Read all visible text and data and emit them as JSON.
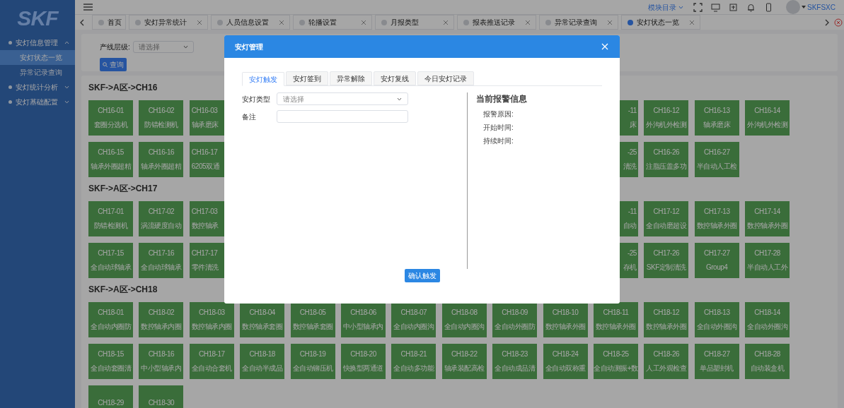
{
  "sidebar": {
    "logo": "SKF",
    "menu": [
      {
        "label": "安灯信息管理",
        "expanded": true,
        "children": [
          {
            "label": "安灯状态一览",
            "selected": true
          },
          {
            "label": "异常记录查询",
            "selected": false
          }
        ]
      },
      {
        "label": "安灯统计分析",
        "expanded": false
      },
      {
        "label": "安灯基础配置",
        "expanded": false
      }
    ]
  },
  "header": {
    "module_menu": "模块目录",
    "user": "SKFSXC"
  },
  "tabs": [
    {
      "label": "首页",
      "selected": false,
      "closable": false
    },
    {
      "label": "安灯异常统计",
      "selected": false,
      "closable": true
    },
    {
      "label": "人员信息设置",
      "selected": false,
      "closable": true
    },
    {
      "label": "轮播设置",
      "selected": false,
      "closable": true
    },
    {
      "label": "月报类型",
      "selected": false,
      "closable": true
    },
    {
      "label": "报表推送记录",
      "selected": false,
      "closable": true
    },
    {
      "label": "异常记录查询",
      "selected": false,
      "closable": true
    },
    {
      "label": "安灯状态一览",
      "selected": true,
      "closable": true
    }
  ],
  "filter": {
    "label": "产线层级:",
    "select": {
      "placeholder": "请选择"
    },
    "button": "查询"
  },
  "groups": [
    {
      "title": "SKF->A区->CH16",
      "rows": [
        {
          "left": [
            {
              "code": "CH16-01",
              "name": "套圈分选机"
            },
            {
              "code": "CH16-02",
              "name": "防错检测机"
            },
            {
              "code": "CH16-03",
              "name": "轴承磨床"
            }
          ],
          "right": [
            {
              "code": "-11",
              "name": "床"
            },
            {
              "code": "CH16-12",
              "name": "外沟机外检测"
            },
            {
              "code": "CH16-13",
              "name": "轴承磨床"
            },
            {
              "code": "CH16-14",
              "name": "外沟机外检测"
            }
          ]
        },
        {
          "left": [
            {
              "code": "CH16-15",
              "name": "轴承外圈超精"
            },
            {
              "code": "CH16-16",
              "name": "轴承外圈超精"
            },
            {
              "code": "CH16-17",
              "name": "6205双通"
            }
          ],
          "right": [
            {
              "code": "-25",
              "name": "清洗"
            },
            {
              "code": "CH16-26",
              "name": "注脂压盖多功"
            },
            {
              "code": "CH16-27",
              "name": "半自动人工检"
            }
          ]
        }
      ]
    },
    {
      "title": "SKF->A区->CH17",
      "rows": [
        {
          "left": [
            {
              "code": "CH17-01",
              "name": "防错检测机"
            },
            {
              "code": "CH17-02",
              "name": "涡流硬度自动"
            },
            {
              "code": "CH17-03",
              "name": "数控轴承"
            }
          ],
          "right": [
            {
              "code": "-11",
              "name": "自动"
            },
            {
              "code": "CH17-12",
              "name": "全自动磨超设"
            },
            {
              "code": "CH17-13",
              "name": "数控轴承外圈"
            },
            {
              "code": "CH17-14",
              "name": "数控轴承外圈"
            }
          ]
        },
        {
          "left": [
            {
              "code": "CH17-15",
              "name": "全自动球轴承"
            },
            {
              "code": "CH17-16",
              "name": "全自动球轴承"
            },
            {
              "code": "CH17-17",
              "name": "零件清洗"
            }
          ],
          "right": [
            {
              "code": "-25",
              "name": "存机"
            },
            {
              "code": "CH17-26",
              "name": "SKF定制清洗"
            },
            {
              "code": "CH17-27",
              "name": "Group4"
            },
            {
              "code": "CH17-28",
              "name": "半自动人工外"
            }
          ]
        }
      ]
    },
    {
      "title": "SKF->A区->CH18",
      "rows": [
        {
          "left": [
            {
              "code": "CH18-01",
              "name": "全自动内圈防"
            },
            {
              "code": "CH18-02",
              "name": "数控轴承内圈"
            },
            {
              "code": "CH18-03",
              "name": "数控轴承内圈"
            },
            {
              "code": "CH18-04",
              "name": "数控轴承套圈"
            },
            {
              "code": "CH18-05",
              "name": "数控轴承套圈"
            },
            {
              "code": "CH18-06",
              "name": "中小型轴承内"
            },
            {
              "code": "CH18-07",
              "name": "全自动内圈沟"
            },
            {
              "code": "CH18-08",
              "name": "全自动内圈沟"
            },
            {
              "code": "CH18-09",
              "name": "全自动外圈防"
            },
            {
              "code": "CH18-10",
              "name": "数控轴承外圈"
            },
            {
              "code": "CH18-11",
              "name": "数控轴承外圈"
            },
            {
              "code": "CH18-12",
              "name": "数控轴承外圈"
            },
            {
              "code": "CH18-13",
              "name": "全自动外圈沟"
            },
            {
              "code": "CH18-14",
              "name": "全自动外圈沟"
            }
          ]
        },
        {
          "left": [
            {
              "code": "CH18-15",
              "name": "全自动套圈清"
            },
            {
              "code": "CH18-16",
              "name": "中小型轴承内"
            },
            {
              "code": "CH18-17",
              "name": "全自动合套机"
            },
            {
              "code": "CH18-18",
              "name": "全自动半成品"
            },
            {
              "code": "CH18-19",
              "name": "全自动铆压机"
            },
            {
              "code": "CH18-20",
              "name": "快换型两通道"
            },
            {
              "code": "CH18-21",
              "name": "全自动多功能"
            },
            {
              "code": "CH18-22",
              "name": "轴承装配高检"
            },
            {
              "code": "CH18-23",
              "name": "全自动成品清"
            },
            {
              "code": "CH18-24",
              "name": "全自动双称重"
            },
            {
              "code": "CH18-25",
              "name": "全自动测振+数"
            },
            {
              "code": "CH18-26",
              "name": "人工外观检查"
            },
            {
              "code": "CH18-27",
              "name": "单品塑封机"
            },
            {
              "code": "CH18-28",
              "name": "自动装盒机"
            }
          ]
        },
        {
          "left": [
            {
              "code": "CH18-29"
            },
            {
              "code": "CH18-30"
            }
          ]
        }
      ]
    }
  ],
  "modal": {
    "title": "安灯管理",
    "tabs": [
      {
        "label": "安灯触发",
        "selected": true
      },
      {
        "label": "安灯签到",
        "selected": false
      },
      {
        "label": "异常解除",
        "selected": false
      },
      {
        "label": "安灯复线",
        "selected": false
      },
      {
        "label": "今日安灯记录",
        "selected": false
      }
    ],
    "form": [
      {
        "kind": "select",
        "label": "安灯类型",
        "placeholder": "请选择"
      },
      {
        "kind": "input",
        "label": "备注"
      }
    ],
    "info": {
      "title": "当前报警信息",
      "fields": [
        "报警原因:",
        "开始时间:",
        "持续时间:"
      ]
    },
    "confirm_button": "确认触发"
  }
}
